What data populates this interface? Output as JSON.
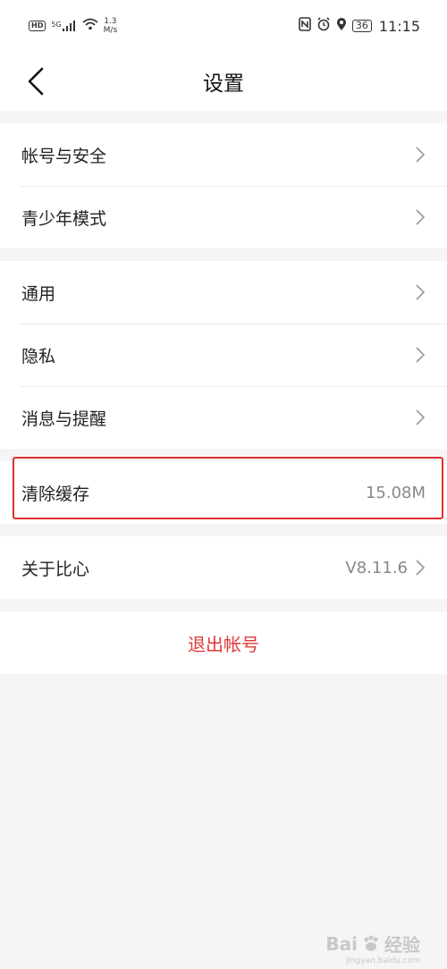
{
  "status_bar": {
    "hd": "HD",
    "signal": "5G",
    "net_speed_value": "1.3",
    "net_speed_unit": "M/s",
    "battery": "36",
    "time": "11:15"
  },
  "nav": {
    "title": "设置"
  },
  "groups": {
    "account": [
      {
        "label": "帐号与安全"
      },
      {
        "label": "青少年模式"
      }
    ],
    "general": [
      {
        "label": "通用"
      },
      {
        "label": "隐私"
      },
      {
        "label": "消息与提醒"
      }
    ],
    "cache": {
      "label": "清除缓存",
      "value": "15.08M"
    },
    "about": {
      "label": "关于比心",
      "value": "V8.11.6"
    }
  },
  "logout": {
    "label": "退出帐号"
  },
  "watermark": {
    "text": "Bai",
    "text2": "经验",
    "sub": "jingyan.baidu.com"
  },
  "colors": {
    "accent_red": "#e03b3b",
    "highlight_border": "#e03030"
  }
}
